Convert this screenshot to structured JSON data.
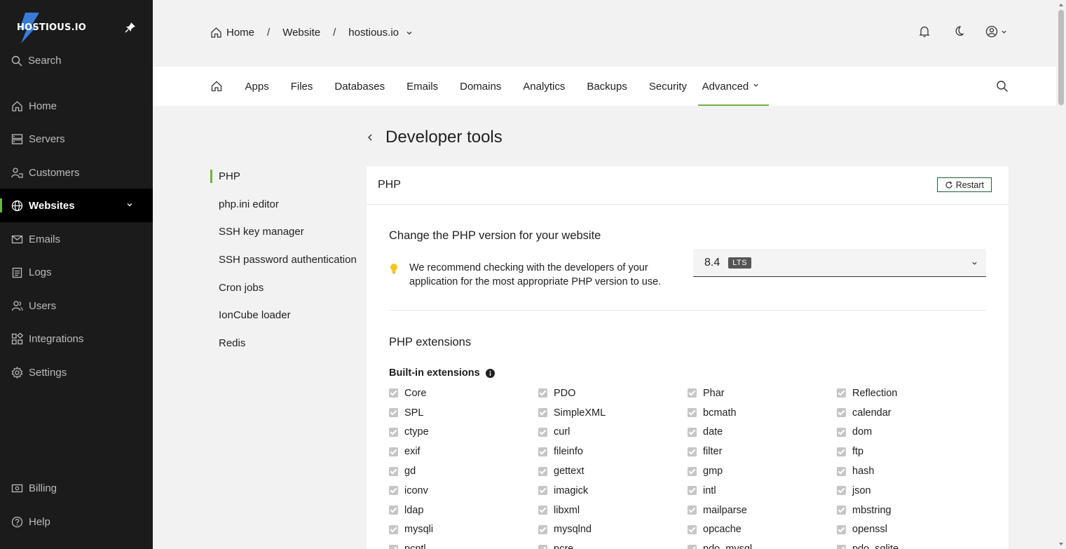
{
  "brand": {
    "name": "HOSTIOUS.IO",
    "accent": "#6db33f"
  },
  "sidebar": {
    "search_label": "Search",
    "items": [
      {
        "label": "Home",
        "icon": "home-icon"
      },
      {
        "label": "Servers",
        "icon": "server-icon"
      },
      {
        "label": "Customers",
        "icon": "customers-icon"
      },
      {
        "label": "Websites",
        "icon": "globe-icon",
        "active": true
      },
      {
        "label": "Emails",
        "icon": "mail-icon"
      },
      {
        "label": "Logs",
        "icon": "logs-icon"
      },
      {
        "label": "Users",
        "icon": "users-icon"
      },
      {
        "label": "Integrations",
        "icon": "integrations-icon"
      },
      {
        "label": "Settings",
        "icon": "gear-icon"
      }
    ],
    "bottom": [
      {
        "label": "Billing",
        "icon": "billing-icon"
      },
      {
        "label": "Help",
        "icon": "help-icon"
      }
    ]
  },
  "breadcrumb": {
    "home": "Home",
    "sep": "/",
    "section": "Website",
    "site": "hostious.io"
  },
  "tabs": [
    "Apps",
    "Files",
    "Databases",
    "Emails",
    "Domains",
    "Analytics",
    "Backups",
    "Security",
    "Advanced"
  ],
  "page": {
    "title": "Developer tools"
  },
  "subnav": [
    "PHP",
    "php.ini editor",
    "SSH key manager",
    "SSH password authentication",
    "Cron jobs",
    "IonCube loader",
    "Redis"
  ],
  "card": {
    "title": "PHP",
    "restart_label": "Restart",
    "version_heading": "Change the PHP version for your website",
    "tip_line1": "We recommend checking with the developers of your",
    "tip_line2": "application for the most appropriate PHP version to use.",
    "version_value": "8.4",
    "version_badge": "LTS",
    "extensions_heading": "PHP extensions",
    "builtin_label": "Built-in extensions",
    "extensions": [
      "Core",
      "PDO",
      "Phar",
      "Reflection",
      "SPL",
      "SimpleXML",
      "bcmath",
      "calendar",
      "ctype",
      "curl",
      "date",
      "dom",
      "exif",
      "fileinfo",
      "filter",
      "ftp",
      "gd",
      "gettext",
      "gmp",
      "hash",
      "iconv",
      "imagick",
      "intl",
      "json",
      "ldap",
      "libxml",
      "mailparse",
      "mbstring",
      "mysqli",
      "mysqlnd",
      "opcache",
      "openssl",
      "pcntl",
      "pcre",
      "pdo_mysql",
      "pdo_sqlite"
    ]
  }
}
